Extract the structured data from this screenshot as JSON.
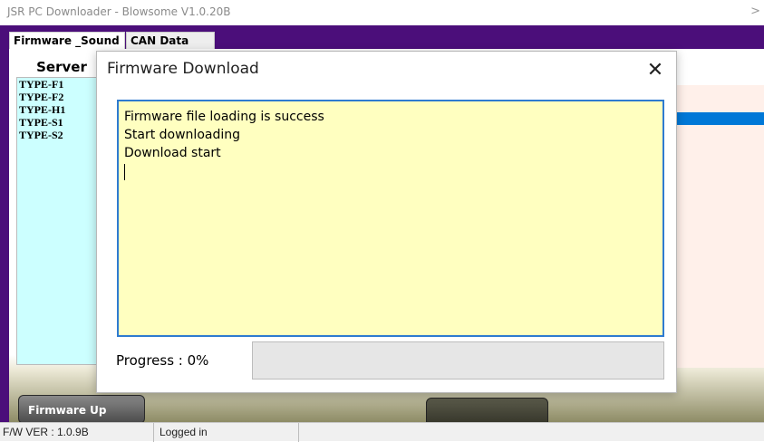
{
  "window": {
    "title": "JSR PC Downloader - Blowsome V1.0.20B"
  },
  "tabs": [
    {
      "label": "Firmware _Sound"
    },
    {
      "label": "CAN Data Log"
    }
  ],
  "server": {
    "header": "Server",
    "items": [
      "TYPE-F1",
      "TYPE-F2",
      "TYPE-H1",
      "TYPE-S1",
      "TYPE-S2"
    ]
  },
  "buttons": {
    "firmware_update": "Firmware Up",
    "sound_download": ""
  },
  "statusbar": {
    "fw_version": "F/W VER : 1.0.9B",
    "login_status": "Logged in"
  },
  "dialog": {
    "title": "Firmware Download",
    "log_lines": [
      "Firmware file loading is success",
      "Start downloading",
      "Download start"
    ],
    "progress_label": "Progress : 0%",
    "progress_fraction": 0
  },
  "colors": {
    "app_background": "#4b0e7a",
    "server_list_bg": "#ccffff",
    "log_bg": "#ffffc0",
    "log_border": "#2e7bd0",
    "selection": "#0078d7",
    "progress_fill": "#06b025"
  }
}
